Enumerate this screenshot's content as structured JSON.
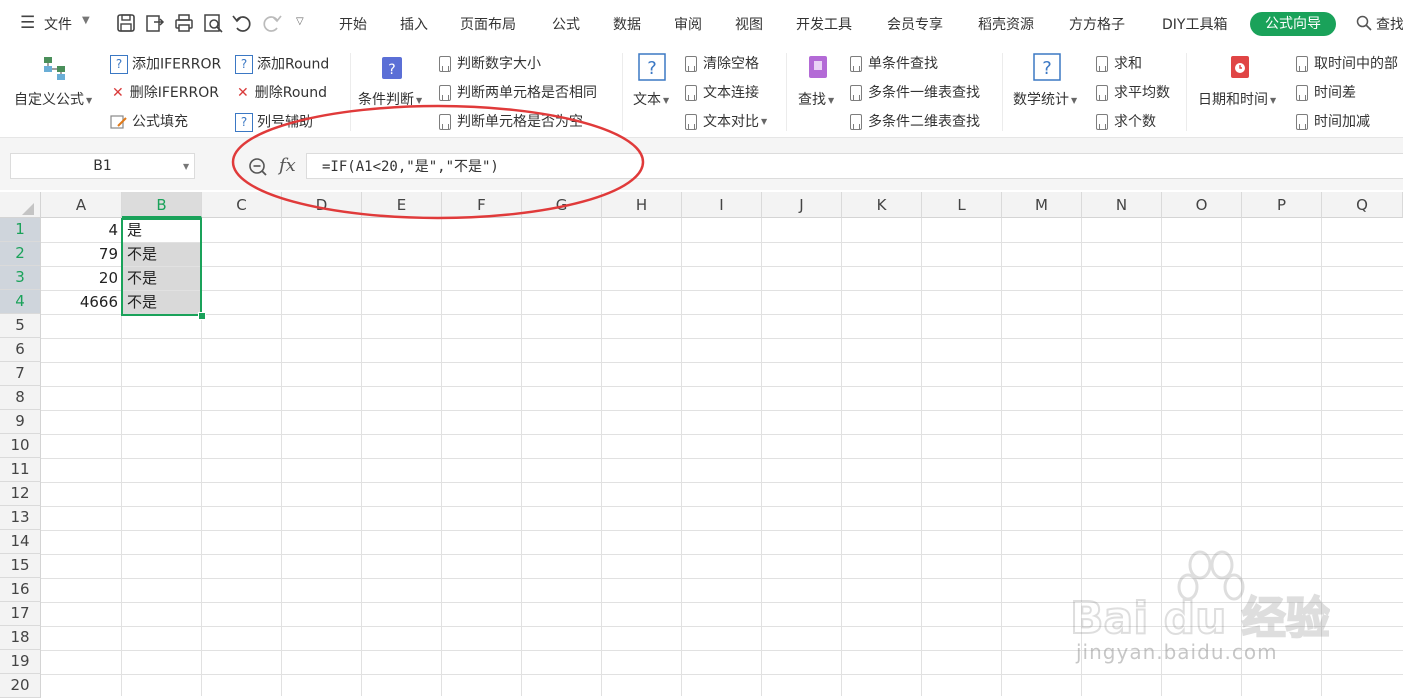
{
  "menu": {
    "file_label": "文件",
    "tabs": [
      "开始",
      "插入",
      "页面布局",
      "公式",
      "数据",
      "审阅",
      "视图",
      "开发工具",
      "会员专享",
      "稻壳资源",
      "方方格子",
      "DIY工具箱"
    ],
    "active_tab": "公式向导",
    "search_label": "查找"
  },
  "ribbon": {
    "custom_formula": "自定义公式",
    "add_iferror": "添加IFERROR",
    "del_iferror": "删除IFERROR",
    "formula_fill": "公式填充",
    "add_round": "添加Round",
    "del_round": "删除Round",
    "col_helper": "列号辅助",
    "cond_judge": "条件判断",
    "judge_size": "判断数字大小",
    "judge_same": "判断两单元格是否相同",
    "judge_empty": "判断单元格是否为空",
    "text": "文本",
    "clear_space": "清除空格",
    "text_join": "文本连接",
    "text_compare": "文本对比",
    "find": "查找",
    "single_find": "单条件查找",
    "multi_1d": "多条件一维表查找",
    "multi_2d": "多条件二维表查找",
    "math_stats": "数学统计",
    "sum": "求和",
    "average": "求平均数",
    "count": "求个数",
    "datetime": "日期和时间",
    "take_time_part": "取时间中的部",
    "time_diff": "时间差",
    "time_add": "时间加减"
  },
  "formula_bar": {
    "name_box": "B1",
    "fx": "fx",
    "formula": "=IF(A1<20,\"是\",\"不是\")"
  },
  "sheet": {
    "columns": [
      "A",
      "B",
      "C",
      "D",
      "E",
      "F",
      "G",
      "H",
      "I",
      "J",
      "K",
      "L",
      "M",
      "N",
      "O",
      "P",
      "Q"
    ],
    "rows": [
      "1",
      "2",
      "3",
      "4",
      "5",
      "6",
      "7",
      "8",
      "9",
      "10",
      "11",
      "12",
      "13",
      "14",
      "15",
      "16",
      "17",
      "18",
      "19",
      "20"
    ],
    "colA": [
      "4",
      "79",
      "20",
      "4666"
    ],
    "colB": [
      "是",
      "不是",
      "不是",
      "不是"
    ],
    "selected_range": "B1:B4"
  },
  "watermark": {
    "brand": "Bai du 经验",
    "url": "jingyan.baidu.com"
  },
  "colors": {
    "accent": "#1aa25a",
    "annotation": "#e03a3a"
  }
}
